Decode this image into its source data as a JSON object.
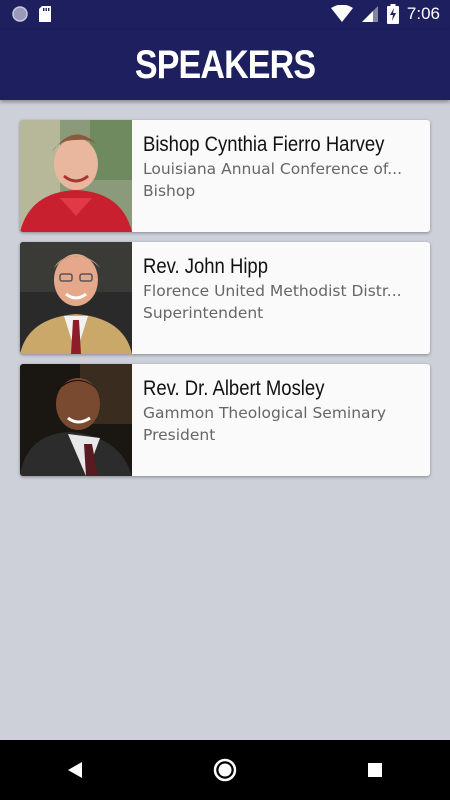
{
  "status_bar": {
    "time": "7:06"
  },
  "header": {
    "title": "SPEAKERS"
  },
  "speakers": [
    {
      "name": "Bishop Cynthia Fierro Harvey",
      "organization": "Louisiana Annual Conference of...",
      "role": "Bishop"
    },
    {
      "name": "Rev. John Hipp",
      "organization": "Florence United Methodist Distr...",
      "role": "Superintendent"
    },
    {
      "name": "Rev. Dr. Albert Mosley",
      "organization": "Gammon Theological Seminary",
      "role": "President"
    }
  ],
  "colors": {
    "header_bg": "#1e1f5e",
    "page_bg": "#cdd0d9",
    "card_bg": "#fafafa",
    "nav_bg": "#000000"
  }
}
